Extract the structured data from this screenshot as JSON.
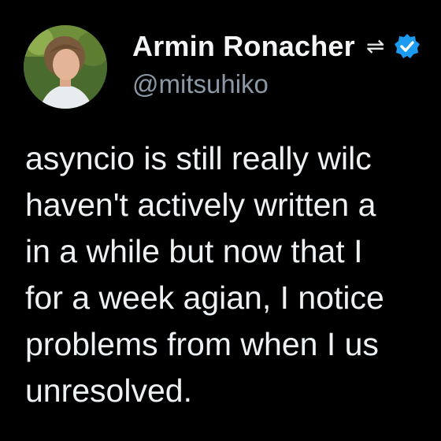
{
  "author": {
    "display_name": "Armin Ronacher",
    "handle": "@mitsuhiko",
    "badge_icon": "verified-check-icon",
    "link_icon": "arrows-exchange-icon",
    "badge_color": "#1d9bf0"
  },
  "tweet": {
    "lines": [
      "asyncio is still really wilc",
      "haven't actively written a",
      "in a while but now that I",
      "for a week agian, I notice",
      "problems from when I us",
      "unresolved."
    ]
  },
  "colors": {
    "background": "#000000",
    "text": "#e7e9ea",
    "handle": "#8b98a5"
  }
}
